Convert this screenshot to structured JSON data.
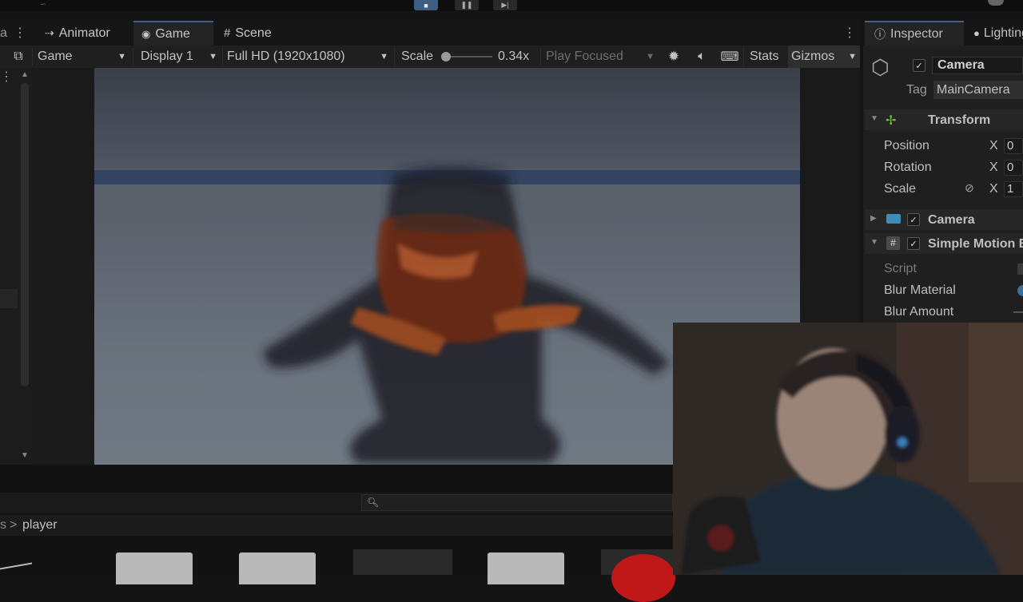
{
  "top_bar": {
    "stop_icon": "stop-icon",
    "pause_icon": "pause-icon",
    "step_icon": "step-icon"
  },
  "tabs": {
    "animator": "Animator",
    "game": "Game",
    "scene": "Scene"
  },
  "game_toolbar": {
    "view_mode": "Game",
    "display": "Display 1",
    "resolution": "Full HD (1920x1080)",
    "scale_label": "Scale",
    "scale_value": "0.34x",
    "play_mode": "Play Focused",
    "stats": "Stats",
    "gizmos": "Gizmos"
  },
  "inspector": {
    "tab_inspector": "Inspector",
    "tab_lighting": "Lighting",
    "object_name": "Camera",
    "tag_label": "Tag",
    "tag_value": "MainCamera",
    "transform": {
      "title": "Transform",
      "rows": [
        {
          "label": "Position",
          "axis": "X",
          "value": "0"
        },
        {
          "label": "Rotation",
          "axis": "X",
          "value": "0"
        },
        {
          "label": "Scale",
          "axis": "X",
          "value": "1"
        }
      ]
    },
    "camera_component": "Camera",
    "script_component": "Simple Motion Blur",
    "script_label": "Script",
    "blur_material_label": "Blur Material",
    "blur_amount_label": "Blur Amount"
  },
  "project": {
    "breadcrumb_sep": ">",
    "breadcrumb_folder": "player"
  },
  "colors": {
    "accent": "#3d5f86",
    "panel": "#1f1f1f",
    "sky": "#4f5561"
  }
}
